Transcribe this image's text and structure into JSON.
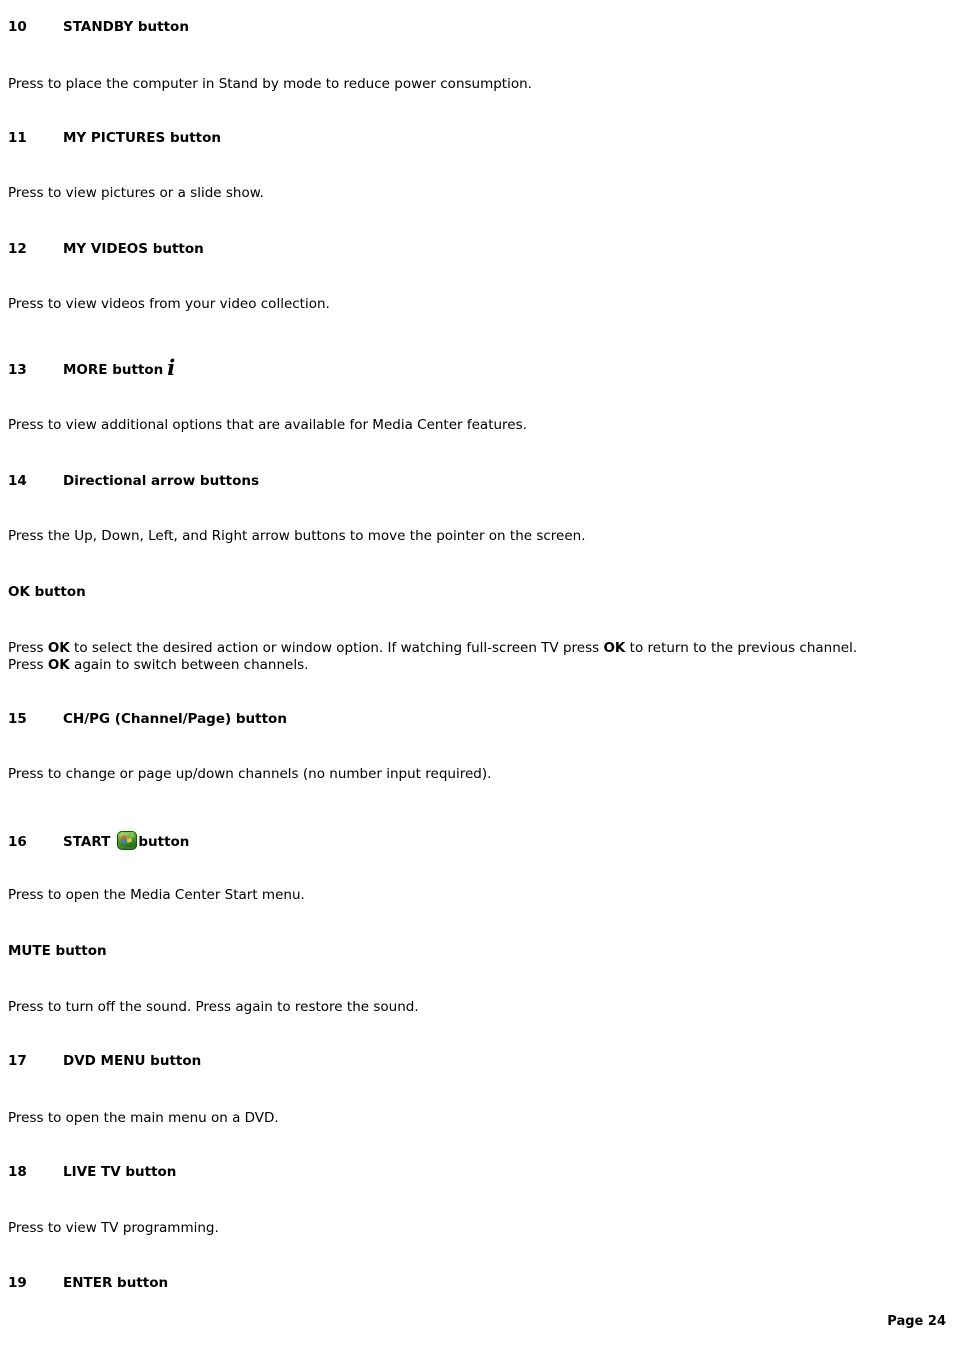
{
  "document": {
    "page_label": "Page 24",
    "entries": [
      {
        "number": "10",
        "label": "STANDBY button",
        "icon": null,
        "body": "Press to place the computer in Stand by mode to reduce power consumption."
      },
      {
        "number": "11",
        "label": "MY PICTURES button",
        "icon": null,
        "body": "Press to view pictures or a slide show."
      },
      {
        "number": "12",
        "label": "MY VIDEOS button",
        "icon": null,
        "body": "Press to view videos from your video collection."
      },
      {
        "number": "13",
        "label": "MORE button",
        "icon": "more-info-i-icon",
        "icon_glyph": "i",
        "body": "Press to view additional options that are available for Media Center features."
      },
      {
        "number": "14",
        "label": "Directional arrow buttons",
        "icon": null,
        "body": "Press the Up, Down, Left, and Right arrow buttons to move the pointer on the screen."
      },
      {
        "number": "",
        "label": "OK button",
        "icon": null,
        "body_parts": [
          {
            "text": "Press ",
            "bold": false
          },
          {
            "text": "OK",
            "bold": true
          },
          {
            "text": " to select the desired action or window option. If watching full-screen TV press ",
            "bold": false
          },
          {
            "text": "OK",
            "bold": true
          },
          {
            "text": " to return to the previous channel. Press ",
            "bold": false
          },
          {
            "text": "OK",
            "bold": true
          },
          {
            "text": " again to switch between channels.",
            "bold": false
          }
        ]
      },
      {
        "number": "15",
        "label": "CH/PG (Channel/Page) button",
        "icon": null,
        "body": "Press to change or page up/down channels (no number input required)."
      },
      {
        "number": "16",
        "label": "START",
        "label_suffix": "button",
        "icon": "windows-media-center-start-icon",
        "body": "Press to open the Media Center Start menu."
      },
      {
        "number": "",
        "label": "MUTE button",
        "icon": null,
        "body": "Press to turn off the sound. Press again to restore the sound."
      },
      {
        "number": "17",
        "label": "DVD MENU button",
        "icon": null,
        "body": "Press to open the main menu on a DVD."
      },
      {
        "number": "18",
        "label": "LIVE TV button",
        "icon": null,
        "body": "Press to view TV programming."
      },
      {
        "number": "19",
        "label": "ENTER button",
        "icon": null,
        "body": ""
      }
    ]
  },
  "colors": {
    "text": "#000000",
    "background": "#ffffff",
    "start_icon_green_light": "#8fd14f",
    "start_icon_green_dark": "#2f7a1e",
    "start_icon_flag_red": "#e8523f",
    "start_icon_flag_green": "#7ab648",
    "start_icon_flag_blue": "#3d7ec4",
    "start_icon_flag_yellow": "#f2c236"
  }
}
